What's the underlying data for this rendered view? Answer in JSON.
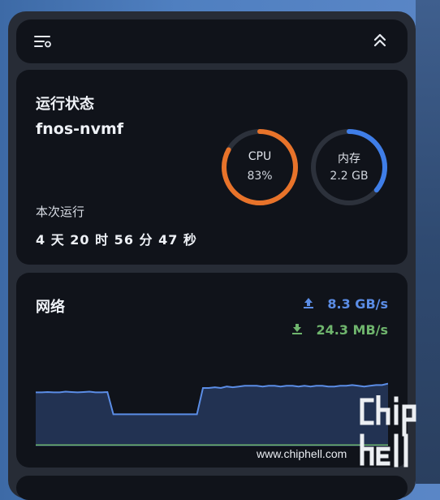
{
  "toolbar": {
    "left_icon": "filter-settings-icon",
    "right_icon": "chevrons-up-icon"
  },
  "status": {
    "title": "运行状态",
    "hostname": "fnos-nvmf",
    "uptime_label": "本次运行",
    "uptime_value": "4 天 20 时 56 分 47 秒",
    "cpu": {
      "label": "CPU",
      "value": "83%",
      "percent": 83,
      "color": "#e8732a"
    },
    "memory": {
      "label": "内存",
      "value": "2.2 GB",
      "percent": 36,
      "color": "#3f7ee8"
    }
  },
  "network": {
    "title": "网络",
    "upload_rate": "8.3 GB/s",
    "download_rate": "24.3 MB/s",
    "upload_color": "#5b8de6",
    "download_color": "#6fb56d",
    "upload_series": [
      0.74,
      0.74,
      0.745,
      0.74,
      0.74,
      0.75,
      0.745,
      0.74,
      0.745,
      0.75,
      0.74,
      0.74,
      0.745,
      0.44,
      0.44,
      0.44,
      0.44,
      0.44,
      0.44,
      0.44,
      0.44,
      0.44,
      0.44,
      0.44,
      0.44,
      0.44,
      0.44,
      0.44,
      0.8,
      0.8,
      0.81,
      0.8,
      0.82,
      0.81,
      0.82,
      0.83,
      0.83,
      0.83,
      0.82,
      0.83,
      0.83,
      0.82,
      0.83,
      0.83,
      0.82,
      0.83,
      0.82,
      0.83,
      0.83,
      0.82,
      0.82,
      0.83,
      0.83,
      0.84,
      0.83,
      0.82,
      0.83,
      0.84,
      0.84,
      0.86
    ],
    "download_series": [
      0.02,
      0.02,
      0.02,
      0.02,
      0.02,
      0.02,
      0.02,
      0.02,
      0.02,
      0.02
    ]
  },
  "watermark": {
    "site": "www.chiphell.com",
    "logo_text": "chip hell"
  }
}
